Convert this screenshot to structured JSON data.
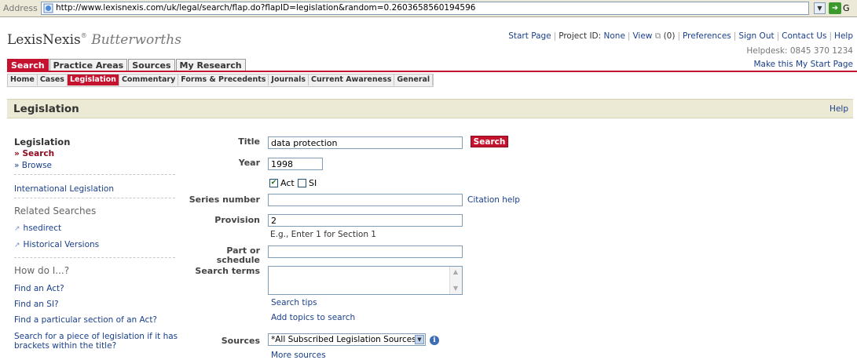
{
  "browser": {
    "address_label": "Address",
    "url": "http://www.lexisnexis.com/uk/legal/search/flap.do?flapID=legislation&random=0.2603658560194596",
    "go_label": "G"
  },
  "header": {
    "logo_main": "LexisNexis",
    "logo_reg": "®",
    "logo_sub": "Butterworths",
    "links": {
      "start_page": "Start Page",
      "project_id_label": "Project ID:",
      "project_id_value": "None",
      "view_label": "View",
      "view_count": "(0)",
      "preferences": "Preferences",
      "sign_out": "Sign Out",
      "contact_us": "Contact Us",
      "help": "Help"
    },
    "helpdesk": "Helpdesk: 0845 370 1234",
    "make_start": "Make this My Start Page"
  },
  "main_tabs": [
    {
      "label": "Search",
      "active": true
    },
    {
      "label": "Practice Areas",
      "active": false
    },
    {
      "label": "Sources",
      "active": false
    },
    {
      "label": "My Research",
      "active": false
    }
  ],
  "sub_tabs": [
    {
      "label": "Home",
      "active": false
    },
    {
      "label": "Cases",
      "active": false
    },
    {
      "label": "Legislation",
      "active": true
    },
    {
      "label": "Commentary",
      "active": false
    },
    {
      "label": "Forms & Precedents",
      "active": false
    },
    {
      "label": "Journals",
      "active": false
    },
    {
      "label": "Current Awareness",
      "active": false
    },
    {
      "label": "General",
      "active": false
    }
  ],
  "section": {
    "title": "Legislation",
    "help": "Help"
  },
  "leftnav": {
    "title": "Legislation",
    "search": "» Search",
    "browse": "» Browse",
    "international": "International Legislation",
    "related_heading": "Related Searches",
    "hsedirect": "hsedirect",
    "historical": "Historical Versions",
    "howdo_heading": "How do I...?",
    "find_act": "Find an Act?",
    "find_si": "Find an SI?",
    "find_section": "Find a particular section of an Act?",
    "find_brackets_1": "Search for a piece of legislation if it has",
    "find_brackets_2": "brackets within the title?"
  },
  "form": {
    "title_label": "Title",
    "title_value": "data protection",
    "search_button": "Search",
    "year_label": "Year",
    "year_value": "1998",
    "act_label": "Act",
    "act_checked": true,
    "si_label": "SI",
    "si_checked": false,
    "series_label": "Series number",
    "series_value": "",
    "citation_help": "Citation help",
    "provision_label": "Provision",
    "provision_value": "2",
    "provision_hint": "E.g., Enter 1 for Section 1",
    "part_label_1": "Part or",
    "part_label_2": "schedule",
    "part_value": "",
    "terms_label": "Search terms",
    "terms_value": "",
    "search_tips": "Search tips",
    "add_topics": "Add topics to search",
    "sources_label": "Sources",
    "sources_value": "*All Subscribed Legislation Sources",
    "more_sources": "More sources"
  },
  "icons": {
    "page": "page-icon",
    "info": "info-icon",
    "external": "external-link-icon"
  },
  "colors": {
    "brand_red": "#c4122f",
    "link_blue": "#1a3f8c",
    "section_bg": "#ecead4"
  }
}
